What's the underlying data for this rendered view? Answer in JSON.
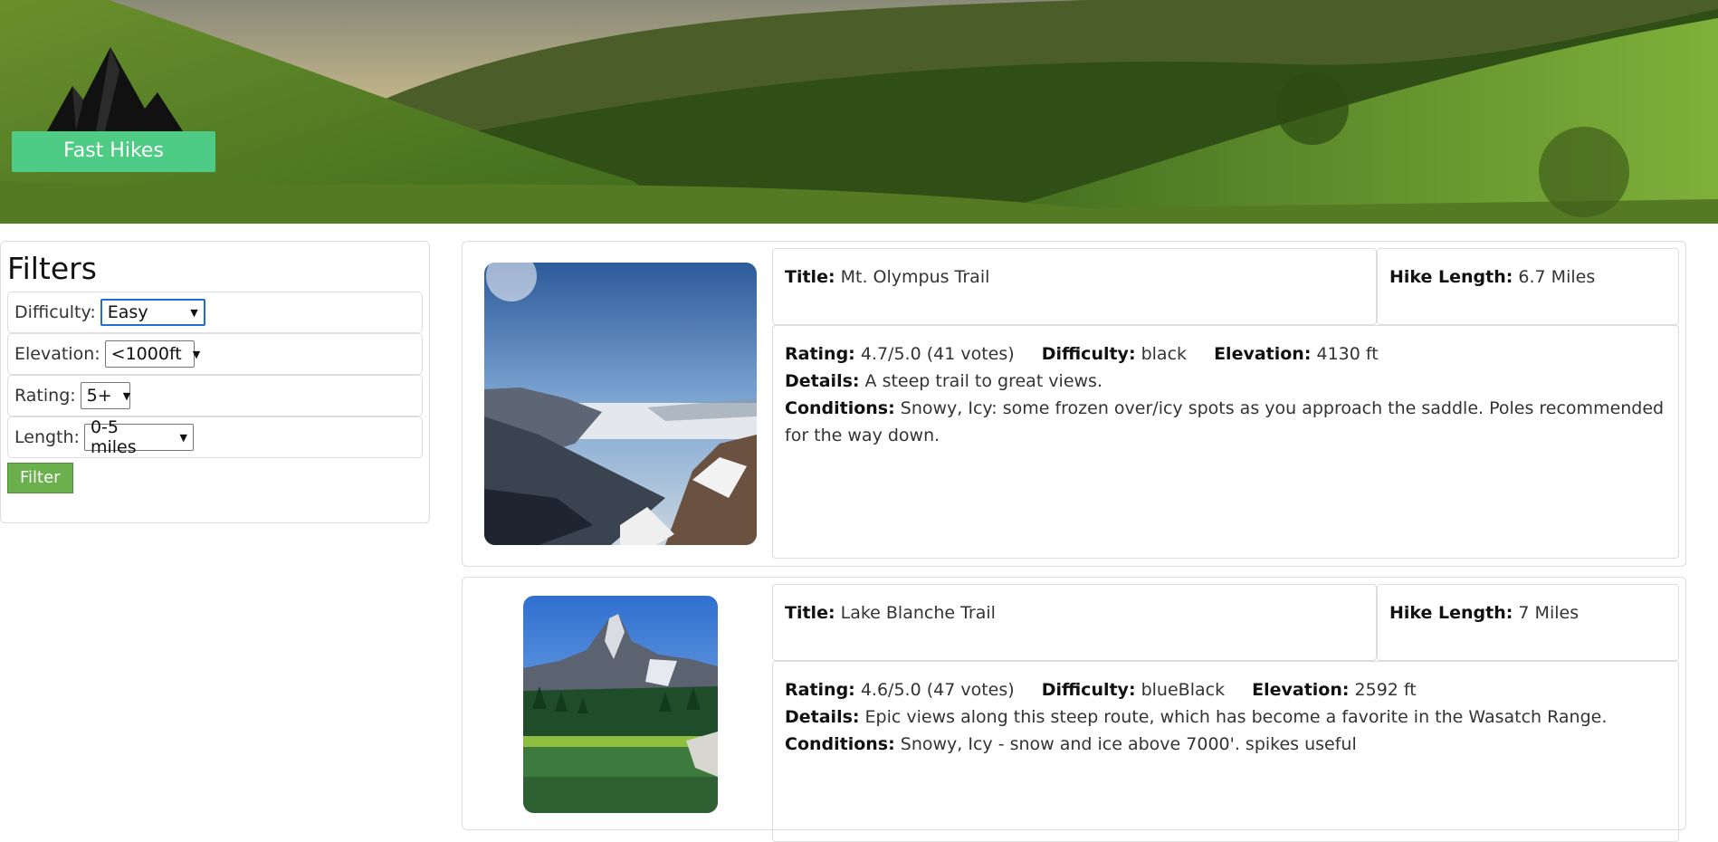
{
  "app": {
    "logo_text": "Fast Hikes"
  },
  "filters": {
    "title": "Filters",
    "difficulty_label": "Difficulty:",
    "difficulty_value": "Easy",
    "elevation_label": "Elevation:",
    "elevation_value": "<1000ft",
    "rating_label": "Rating:",
    "rating_value": "5+",
    "length_label": "Length:",
    "length_value": "0-5 miles",
    "button_label": "Filter"
  },
  "labels": {
    "title": "Title:",
    "length": "Hike Length:",
    "rating": "Rating:",
    "difficulty": "Difficulty:",
    "elevation": "Elevation:",
    "details": "Details:",
    "conditions": "Conditions:"
  },
  "hikes": [
    {
      "title": "Mt. Olympus Trail",
      "length": "6.7 Miles",
      "rating": "4.7/5.0 (41 votes)",
      "difficulty": "black",
      "elevation": "4130 ft",
      "details": "A steep trail to great views.",
      "conditions": "Snowy, Icy: some frozen over/icy spots as you approach the saddle. Poles recommended for the way down."
    },
    {
      "title": "Lake Blanche Trail",
      "length": "7 Miles",
      "rating": "4.6/5.0 (47 votes)",
      "difficulty": "blueBlack",
      "elevation": "2592 ft",
      "details": "Epic views along this steep route, which has become a favorite in the Wasatch Range.",
      "conditions": "Snowy, Icy - snow and ice above 7000'. spikes useful"
    }
  ],
  "colors": {
    "brand_green": "#4ecb84",
    "button_green": "#6ab04c",
    "focus_blue": "#1f6fd1"
  }
}
